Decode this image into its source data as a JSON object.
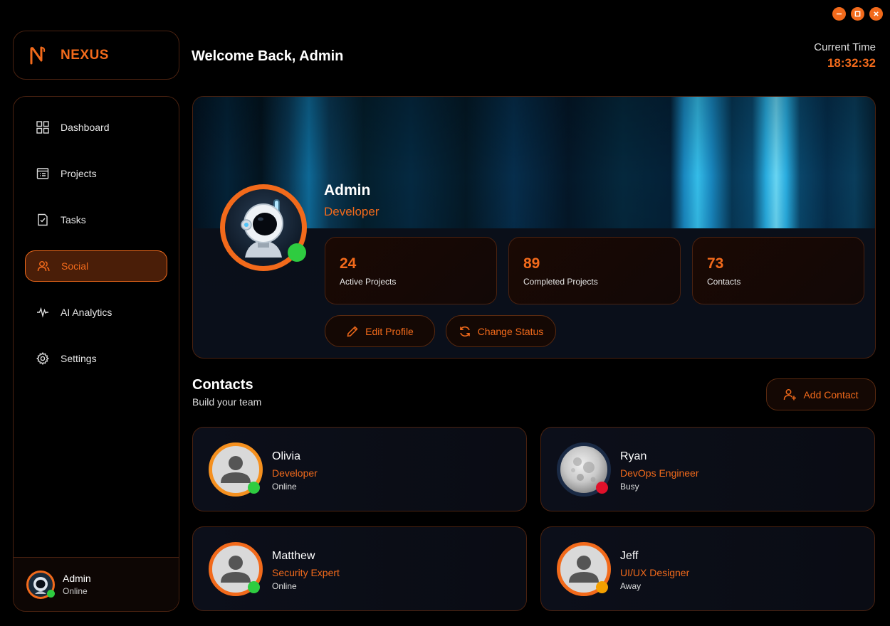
{
  "app": {
    "brand": "NEXUS"
  },
  "header": {
    "welcome": "Welcome Back, Admin",
    "time_label": "Current Time",
    "time_value": "18:32:32"
  },
  "sidebar": {
    "items": [
      {
        "label": "Dashboard",
        "icon": "grid-icon"
      },
      {
        "label": "Projects",
        "icon": "list-icon"
      },
      {
        "label": "Tasks",
        "icon": "checklist-icon"
      },
      {
        "label": "Social",
        "icon": "users-icon",
        "active": true
      },
      {
        "label": "AI Analytics",
        "icon": "pulse-icon"
      },
      {
        "label": "Settings",
        "icon": "gear-icon"
      }
    ],
    "user": {
      "name": "Admin",
      "status": "Online"
    }
  },
  "profile": {
    "name": "Admin",
    "role": "Developer",
    "stats": [
      {
        "value": "24",
        "label": "Active Projects"
      },
      {
        "value": "89",
        "label": "Completed Projects"
      },
      {
        "value": "73",
        "label": "Contacts"
      }
    ],
    "edit_label": "Edit Profile",
    "status_label": "Change Status"
  },
  "contacts": {
    "title": "Contacts",
    "subtitle": "Build your team",
    "add_label": "Add Contact",
    "items": [
      {
        "name": "Olivia",
        "role": "Developer",
        "status": "Online",
        "status_color": "#2ecc40"
      },
      {
        "name": "Ryan",
        "role": "DevOps Engineer",
        "status": "Busy",
        "status_color": "#e0102a"
      },
      {
        "name": "Matthew",
        "role": "Security Expert",
        "status": "Online",
        "status_color": "#2ecc40"
      },
      {
        "name": "Jeff",
        "role": "UI/UX Designer",
        "status": "Away",
        "status_color": "#f5a000"
      }
    ]
  },
  "colors": {
    "accent": "#f26a1b",
    "online": "#2ecc40",
    "busy": "#e0102a",
    "away": "#f5a000"
  }
}
